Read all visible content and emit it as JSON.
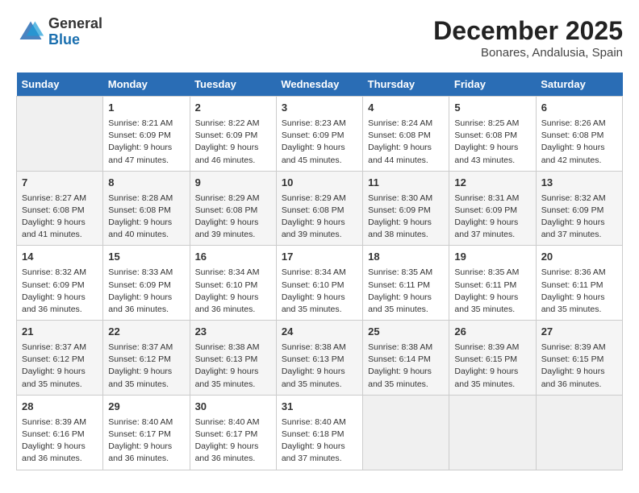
{
  "header": {
    "logo_general": "General",
    "logo_blue": "Blue",
    "month_title": "December 2025",
    "location": "Bonares, Andalusia, Spain"
  },
  "days_of_week": [
    "Sunday",
    "Monday",
    "Tuesday",
    "Wednesday",
    "Thursday",
    "Friday",
    "Saturday"
  ],
  "weeks": [
    [
      {
        "day": "",
        "sunrise": "",
        "sunset": "",
        "daylight": ""
      },
      {
        "day": "1",
        "sunrise": "Sunrise: 8:21 AM",
        "sunset": "Sunset: 6:09 PM",
        "daylight": "Daylight: 9 hours and 47 minutes."
      },
      {
        "day": "2",
        "sunrise": "Sunrise: 8:22 AM",
        "sunset": "Sunset: 6:09 PM",
        "daylight": "Daylight: 9 hours and 46 minutes."
      },
      {
        "day": "3",
        "sunrise": "Sunrise: 8:23 AM",
        "sunset": "Sunset: 6:09 PM",
        "daylight": "Daylight: 9 hours and 45 minutes."
      },
      {
        "day": "4",
        "sunrise": "Sunrise: 8:24 AM",
        "sunset": "Sunset: 6:08 PM",
        "daylight": "Daylight: 9 hours and 44 minutes."
      },
      {
        "day": "5",
        "sunrise": "Sunrise: 8:25 AM",
        "sunset": "Sunset: 6:08 PM",
        "daylight": "Daylight: 9 hours and 43 minutes."
      },
      {
        "day": "6",
        "sunrise": "Sunrise: 8:26 AM",
        "sunset": "Sunset: 6:08 PM",
        "daylight": "Daylight: 9 hours and 42 minutes."
      }
    ],
    [
      {
        "day": "7",
        "sunrise": "Sunrise: 8:27 AM",
        "sunset": "Sunset: 6:08 PM",
        "daylight": "Daylight: 9 hours and 41 minutes."
      },
      {
        "day": "8",
        "sunrise": "Sunrise: 8:28 AM",
        "sunset": "Sunset: 6:08 PM",
        "daylight": "Daylight: 9 hours and 40 minutes."
      },
      {
        "day": "9",
        "sunrise": "Sunrise: 8:29 AM",
        "sunset": "Sunset: 6:08 PM",
        "daylight": "Daylight: 9 hours and 39 minutes."
      },
      {
        "day": "10",
        "sunrise": "Sunrise: 8:29 AM",
        "sunset": "Sunset: 6:08 PM",
        "daylight": "Daylight: 9 hours and 39 minutes."
      },
      {
        "day": "11",
        "sunrise": "Sunrise: 8:30 AM",
        "sunset": "Sunset: 6:09 PM",
        "daylight": "Daylight: 9 hours and 38 minutes."
      },
      {
        "day": "12",
        "sunrise": "Sunrise: 8:31 AM",
        "sunset": "Sunset: 6:09 PM",
        "daylight": "Daylight: 9 hours and 37 minutes."
      },
      {
        "day": "13",
        "sunrise": "Sunrise: 8:32 AM",
        "sunset": "Sunset: 6:09 PM",
        "daylight": "Daylight: 9 hours and 37 minutes."
      }
    ],
    [
      {
        "day": "14",
        "sunrise": "Sunrise: 8:32 AM",
        "sunset": "Sunset: 6:09 PM",
        "daylight": "Daylight: 9 hours and 36 minutes."
      },
      {
        "day": "15",
        "sunrise": "Sunrise: 8:33 AM",
        "sunset": "Sunset: 6:09 PM",
        "daylight": "Daylight: 9 hours and 36 minutes."
      },
      {
        "day": "16",
        "sunrise": "Sunrise: 8:34 AM",
        "sunset": "Sunset: 6:10 PM",
        "daylight": "Daylight: 9 hours and 36 minutes."
      },
      {
        "day": "17",
        "sunrise": "Sunrise: 8:34 AM",
        "sunset": "Sunset: 6:10 PM",
        "daylight": "Daylight: 9 hours and 35 minutes."
      },
      {
        "day": "18",
        "sunrise": "Sunrise: 8:35 AM",
        "sunset": "Sunset: 6:11 PM",
        "daylight": "Daylight: 9 hours and 35 minutes."
      },
      {
        "day": "19",
        "sunrise": "Sunrise: 8:35 AM",
        "sunset": "Sunset: 6:11 PM",
        "daylight": "Daylight: 9 hours and 35 minutes."
      },
      {
        "day": "20",
        "sunrise": "Sunrise: 8:36 AM",
        "sunset": "Sunset: 6:11 PM",
        "daylight": "Daylight: 9 hours and 35 minutes."
      }
    ],
    [
      {
        "day": "21",
        "sunrise": "Sunrise: 8:37 AM",
        "sunset": "Sunset: 6:12 PM",
        "daylight": "Daylight: 9 hours and 35 minutes."
      },
      {
        "day": "22",
        "sunrise": "Sunrise: 8:37 AM",
        "sunset": "Sunset: 6:12 PM",
        "daylight": "Daylight: 9 hours and 35 minutes."
      },
      {
        "day": "23",
        "sunrise": "Sunrise: 8:38 AM",
        "sunset": "Sunset: 6:13 PM",
        "daylight": "Daylight: 9 hours and 35 minutes."
      },
      {
        "day": "24",
        "sunrise": "Sunrise: 8:38 AM",
        "sunset": "Sunset: 6:13 PM",
        "daylight": "Daylight: 9 hours and 35 minutes."
      },
      {
        "day": "25",
        "sunrise": "Sunrise: 8:38 AM",
        "sunset": "Sunset: 6:14 PM",
        "daylight": "Daylight: 9 hours and 35 minutes."
      },
      {
        "day": "26",
        "sunrise": "Sunrise: 8:39 AM",
        "sunset": "Sunset: 6:15 PM",
        "daylight": "Daylight: 9 hours and 35 minutes."
      },
      {
        "day": "27",
        "sunrise": "Sunrise: 8:39 AM",
        "sunset": "Sunset: 6:15 PM",
        "daylight": "Daylight: 9 hours and 36 minutes."
      }
    ],
    [
      {
        "day": "28",
        "sunrise": "Sunrise: 8:39 AM",
        "sunset": "Sunset: 6:16 PM",
        "daylight": "Daylight: 9 hours and 36 minutes."
      },
      {
        "day": "29",
        "sunrise": "Sunrise: 8:40 AM",
        "sunset": "Sunset: 6:17 PM",
        "daylight": "Daylight: 9 hours and 36 minutes."
      },
      {
        "day": "30",
        "sunrise": "Sunrise: 8:40 AM",
        "sunset": "Sunset: 6:17 PM",
        "daylight": "Daylight: 9 hours and 36 minutes."
      },
      {
        "day": "31",
        "sunrise": "Sunrise: 8:40 AM",
        "sunset": "Sunset: 6:18 PM",
        "daylight": "Daylight: 9 hours and 37 minutes."
      },
      {
        "day": "",
        "sunrise": "",
        "sunset": "",
        "daylight": ""
      },
      {
        "day": "",
        "sunrise": "",
        "sunset": "",
        "daylight": ""
      },
      {
        "day": "",
        "sunrise": "",
        "sunset": "",
        "daylight": ""
      }
    ]
  ]
}
